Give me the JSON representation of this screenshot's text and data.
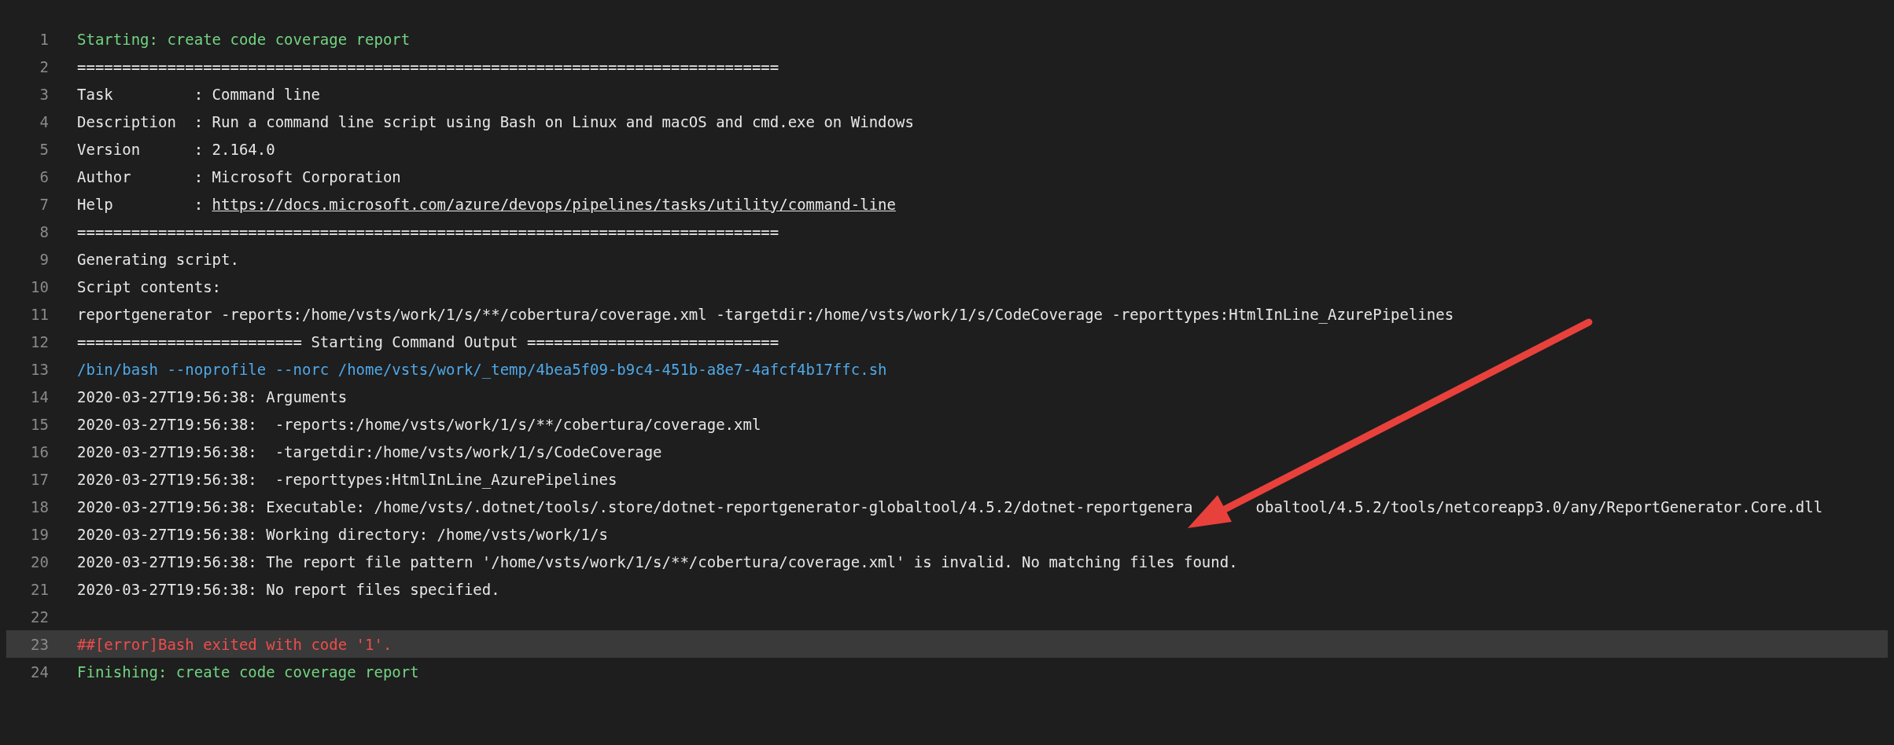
{
  "log_lines": [
    {
      "number": "1",
      "kind": "section",
      "highlighted": false,
      "text": "Starting: create code coverage report"
    },
    {
      "number": "2",
      "kind": "plain",
      "highlighted": false,
      "text": "=============================================================================="
    },
    {
      "number": "3",
      "kind": "plain",
      "highlighted": false,
      "text": "Task         : Command line"
    },
    {
      "number": "4",
      "kind": "plain",
      "highlighted": false,
      "text": "Description  : Run a command line script using Bash on Linux and macOS and cmd.exe on Windows"
    },
    {
      "number": "5",
      "kind": "plain",
      "highlighted": false,
      "text": "Version      : 2.164.0"
    },
    {
      "number": "6",
      "kind": "plain",
      "highlighted": false,
      "text": "Author       : Microsoft Corporation"
    },
    {
      "number": "7",
      "kind": "plain",
      "highlighted": false,
      "text": "Help         : ",
      "link": "https://docs.microsoft.com/azure/devops/pipelines/tasks/utility/command-line"
    },
    {
      "number": "8",
      "kind": "plain",
      "highlighted": false,
      "text": "=============================================================================="
    },
    {
      "number": "9",
      "kind": "plain",
      "highlighted": false,
      "text": "Generating script."
    },
    {
      "number": "10",
      "kind": "plain",
      "highlighted": false,
      "text": "Script contents:"
    },
    {
      "number": "11",
      "kind": "plain",
      "highlighted": false,
      "text": "reportgenerator -reports:/home/vsts/work/1/s/**/cobertura/coverage.xml -targetdir:/home/vsts/work/1/s/CodeCoverage -reporttypes:HtmlInLine_AzurePipelines"
    },
    {
      "number": "12",
      "kind": "plain",
      "highlighted": false,
      "text": "========================= Starting Command Output ============================"
    },
    {
      "number": "13",
      "kind": "command",
      "highlighted": false,
      "text": "/bin/bash --noprofile --norc /home/vsts/work/_temp/4bea5f09-b9c4-451b-a8e7-4afcf4b17ffc.sh"
    },
    {
      "number": "14",
      "kind": "plain",
      "highlighted": false,
      "text": "2020-03-27T19:56:38: Arguments"
    },
    {
      "number": "15",
      "kind": "plain",
      "highlighted": false,
      "text": "2020-03-27T19:56:38:  -reports:/home/vsts/work/1/s/**/cobertura/coverage.xml"
    },
    {
      "number": "16",
      "kind": "plain",
      "highlighted": false,
      "text": "2020-03-27T19:56:38:  -targetdir:/home/vsts/work/1/s/CodeCoverage"
    },
    {
      "number": "17",
      "kind": "plain",
      "highlighted": false,
      "text": "2020-03-27T19:56:38:  -reporttypes:HtmlInLine_AzurePipelines"
    },
    {
      "number": "18",
      "kind": "plain",
      "highlighted": false,
      "text": "2020-03-27T19:56:38: Executable: /home/vsts/.dotnet/tools/.store/dotnet-reportgenerator-globaltool/4.5.2/dotnet-reportgenera",
      "text_after_arrow": "obaltool/4.5.2/tools/netcoreapp3.0/any/ReportGenerator.Core.dll"
    },
    {
      "number": "19",
      "kind": "plain",
      "highlighted": false,
      "text": "2020-03-27T19:56:38: Working directory: /home/vsts/work/1/s"
    },
    {
      "number": "20",
      "kind": "plain",
      "highlighted": false,
      "text": "2020-03-27T19:56:38: The report file pattern '/home/vsts/work/1/s/**/cobertura/coverage.xml' is invalid. No matching files found."
    },
    {
      "number": "21",
      "kind": "plain",
      "highlighted": false,
      "text": "2020-03-27T19:56:38: No report files specified."
    },
    {
      "number": "22",
      "kind": "blank",
      "highlighted": false
    },
    {
      "number": "23",
      "kind": "error",
      "highlighted": true,
      "text": "##[error]Bash exited with code '1'."
    },
    {
      "number": "24",
      "kind": "section",
      "highlighted": false,
      "text": "Finishing: create code coverage report"
    }
  ]
}
